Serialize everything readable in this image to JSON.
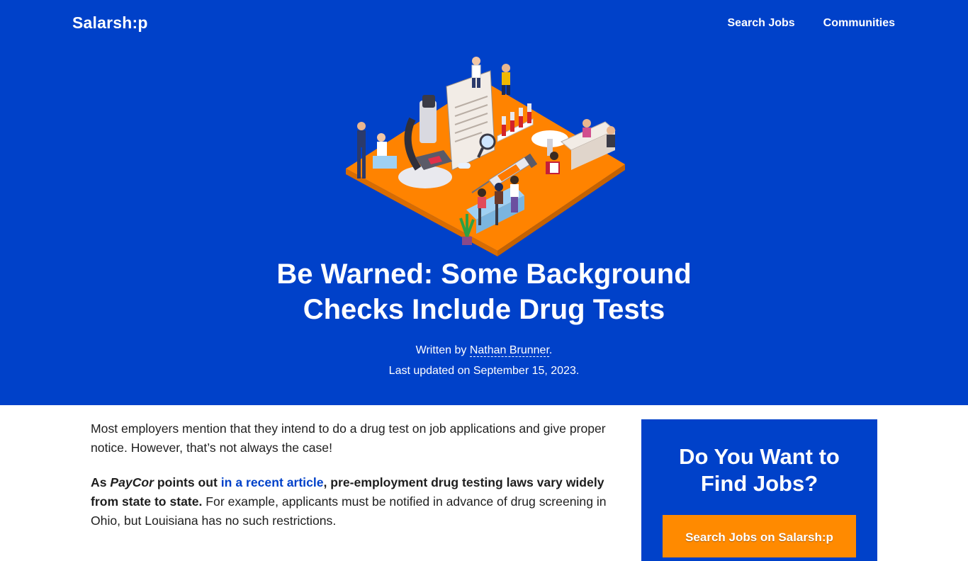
{
  "header": {
    "logo": "Salarsh:p",
    "nav": [
      {
        "label": "Search Jobs"
      },
      {
        "label": "Communities"
      }
    ]
  },
  "hero": {
    "title_line1": "Be Warned: Some Background",
    "title_line2": "Checks Include Drug Tests",
    "written_by_prefix": "Written by ",
    "author": "Nathan Brunner",
    "written_by_suffix": ".",
    "last_updated": "Last updated on September 15, 2023."
  },
  "article": {
    "p1": "Most employers mention that they intend to do a drug test on job applications and give proper notice. However, that’s not always the case!",
    "p2_as": "As ",
    "p2_paycor": "PayCor",
    "p2_points_out": " points out ",
    "p2_link": "in a recent article",
    "p2_bold_rest": ", pre-employment drug testing laws vary widely from state to state.",
    "p2_rest": " For example, applicants must be notified in advance of drug screening in Ohio, but Louisiana has no such restrictions."
  },
  "sidebar": {
    "heading_line1": "Do You Want to",
    "heading_line2": "Find Jobs?",
    "cta_label": "Search Jobs on Salarsh:p"
  },
  "colors": {
    "brand_blue": "#0041c9",
    "accent_orange": "#ff8a00",
    "text": "#1e1e1e"
  }
}
